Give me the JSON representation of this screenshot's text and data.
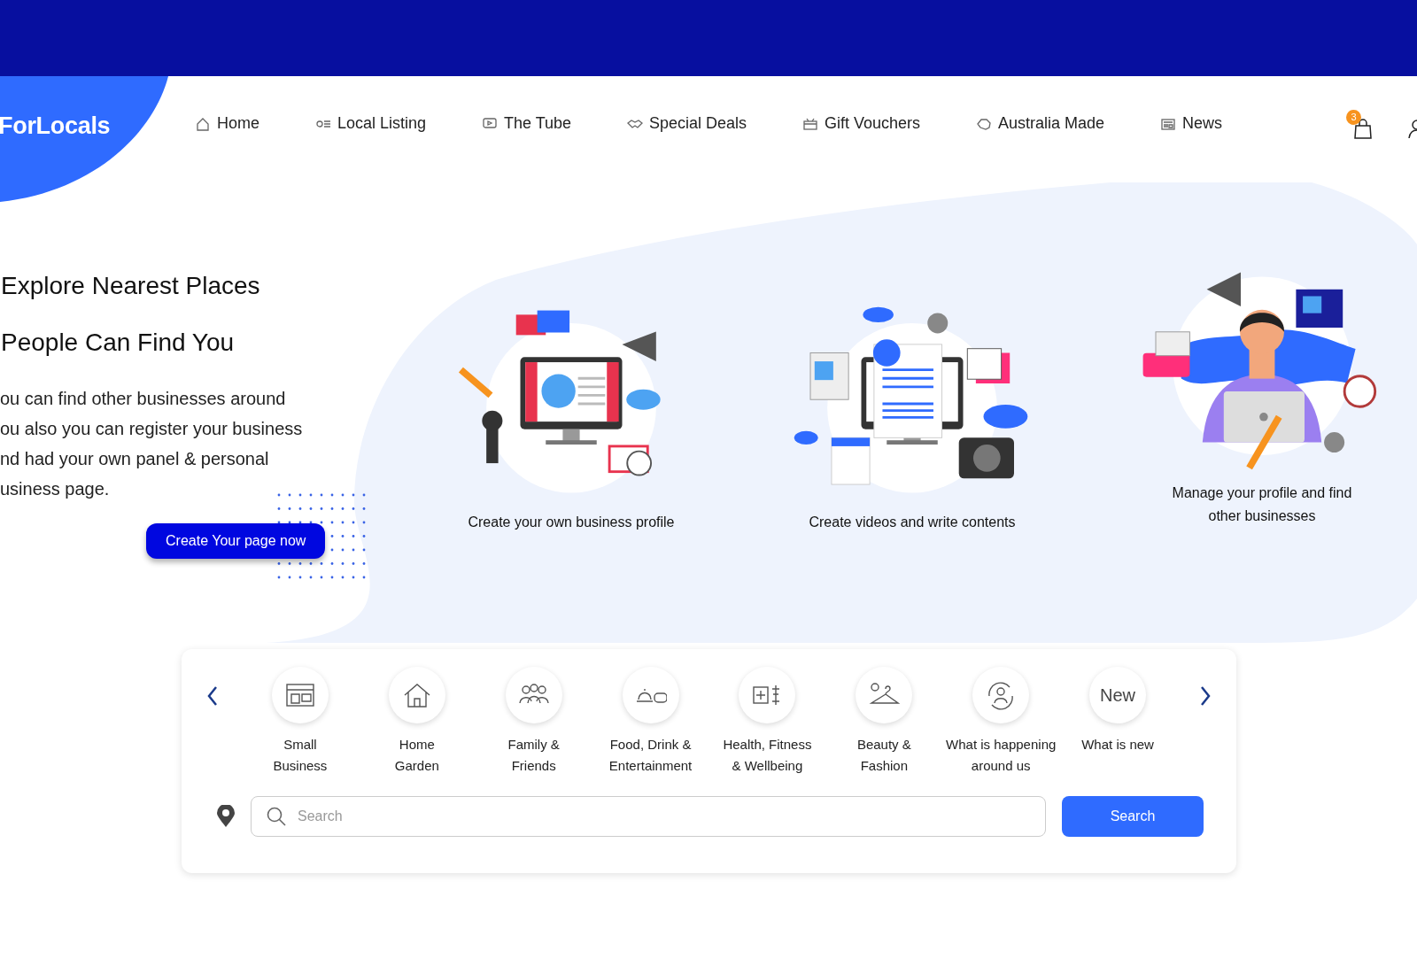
{
  "brand": {
    "name": "ForLocals"
  },
  "nav": [
    {
      "label": "Home"
    },
    {
      "label": "Local Listing"
    },
    {
      "label": "The Tube"
    },
    {
      "label": "Special Deals"
    },
    {
      "label": "Gift Vouchers"
    },
    {
      "label": "Australia Made"
    },
    {
      "label": "News"
    }
  ],
  "cart": {
    "count": "3"
  },
  "hero": {
    "headings": [
      "Explore Nearest Places",
      "People Can Find You"
    ],
    "paragraph": "ou can find other businesses around\nou also you can register your business\nnd had your own panel & personal\nusiness page.",
    "button": "Create Your page now"
  },
  "features": [
    {
      "caption": "Create your own business profile"
    },
    {
      "caption": "Create videos and write contents"
    },
    {
      "caption": "Manage your profile and find\nother businesses"
    }
  ],
  "categories": [
    {
      "kind": "icon",
      "label": "Small\nBusiness"
    },
    {
      "kind": "icon",
      "label": "Home\nGarden"
    },
    {
      "kind": "icon",
      "label": "Family &\nFriends"
    },
    {
      "kind": "icon",
      "label": "Food, Drink &\nEntertainment"
    },
    {
      "kind": "icon",
      "label": "Health, Fitness\n& Wellbeing"
    },
    {
      "kind": "icon",
      "label": "Beauty &\nFashion"
    },
    {
      "kind": "icon",
      "label": "What is happening\naround us"
    },
    {
      "kind": "text",
      "badge_text": "New",
      "label": "What is new"
    }
  ],
  "search": {
    "placeholder": "Search",
    "button": "Search"
  }
}
